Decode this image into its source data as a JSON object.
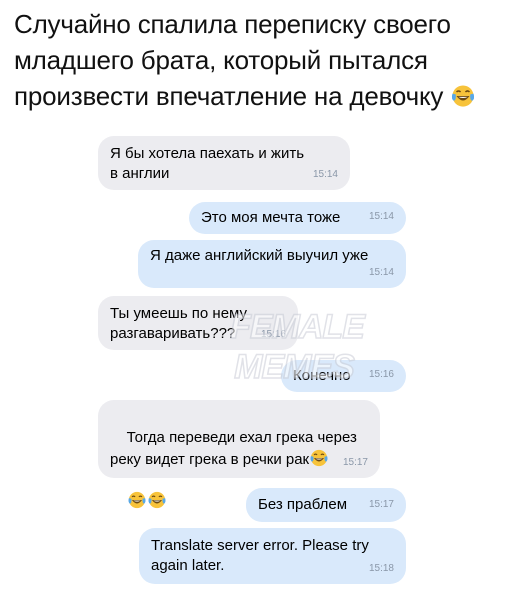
{
  "caption": "Случайно спалила переписку своего младшего брата, который пытался произвести впечатление на девочку",
  "watermark": "FEMALE MEMES",
  "messages": [
    {
      "text": "Я бы хотела паехать и жить в англии",
      "time": "15:14",
      "side": "in"
    },
    {
      "text": "Это моя мечта тоже",
      "time": "15:14",
      "side": "out"
    },
    {
      "text": "Я даже английский выучил уже",
      "time": "15:14",
      "side": "out"
    },
    {
      "text": "Ты умеешь по нему разгаваривать???",
      "time": "15:16",
      "side": "in"
    },
    {
      "text": "Конечно",
      "time": "15:16",
      "side": "out"
    },
    {
      "text": "Тогда переведи ехал грека через реку видет грека в речки рак",
      "time": "15:17",
      "side": "in"
    },
    {
      "text": "Без праблем",
      "time": "15:17",
      "side": "out"
    },
    {
      "text": "Translate server error. Please try again later.",
      "time": "15:18",
      "side": "out"
    }
  ],
  "emoji": {
    "name": "tears-of-joy-emoji",
    "face": "#f7c33b",
    "tear": "#58a8e8"
  }
}
